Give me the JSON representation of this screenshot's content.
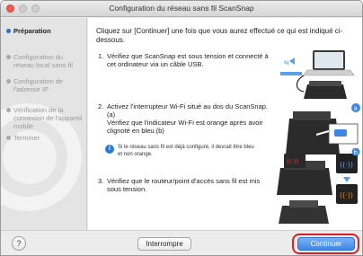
{
  "window": {
    "title": "Configuration du réseau sans fil ScanSnap"
  },
  "sidebar": {
    "steps": [
      {
        "label": "Préparation"
      },
      {
        "label": "Configuration du réseau local sans fil"
      },
      {
        "label": "Configuration de l'adresse IP"
      },
      {
        "label": "Vérification de la connexion de l'appareil mobile"
      },
      {
        "label": "Terminer"
      }
    ]
  },
  "content": {
    "intro": "Cliquez sur [Continuer] une fois que vous aurez effectué ce qui est indiqué ci-dessous.",
    "items": [
      {
        "num": "1.",
        "line1": "Vérifiez que ScanSnap est sous tension et connecté à",
        "line2": "cet ordinateur via un câble USB."
      },
      {
        "num": "2.",
        "line1": "Activez l'interrupteur Wi-Fi situé au dos du ScanSnap.",
        "line2": "(a)",
        "line3": "Vérifiez que l'indicateur Wi-Fi est orange après avoir",
        "line4": "clignoté en bleu.(b)"
      },
      {
        "num": "3.",
        "line1": "Vérifiez que le routeur/point d'accès sans fil est mis",
        "line2": "sous tension."
      }
    ],
    "note": {
      "line1": "Si le réseau sans fil est déjà configuré, il devrait être bleu",
      "line2": "et non orange."
    },
    "markers": {
      "a": "a",
      "b": "b"
    }
  },
  "footer": {
    "help_label": "?",
    "stop_label": "Interrompre",
    "continue_label": "Continuer"
  },
  "colors": {
    "accent": "#3c87e6",
    "highlight": "#d8202a",
    "wifi_orange": "#f08a1c"
  }
}
